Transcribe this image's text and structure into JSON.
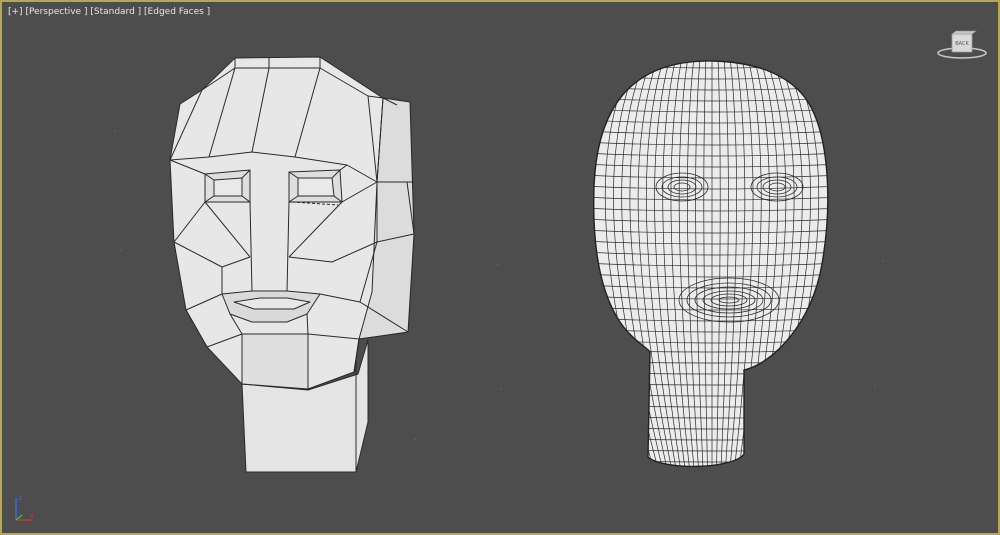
{
  "viewport": {
    "label_plus": "[+]",
    "label_view": "[Perspective ]",
    "label_shading": "[Standard ]",
    "label_edges": "[Edged Faces ]",
    "background_color": "#4d4d4d",
    "border_color": "#b8a650"
  },
  "viewcube": {
    "face_label": "BACK"
  },
  "models": {
    "left": {
      "name": "low-poly-head",
      "color": "#e8e8e8"
    },
    "right": {
      "name": "subdivided-head",
      "color": "#ececec"
    }
  },
  "axis_tripod": {
    "icon": "xyz-axis-icon",
    "z_label": "z",
    "x_label": "x"
  }
}
